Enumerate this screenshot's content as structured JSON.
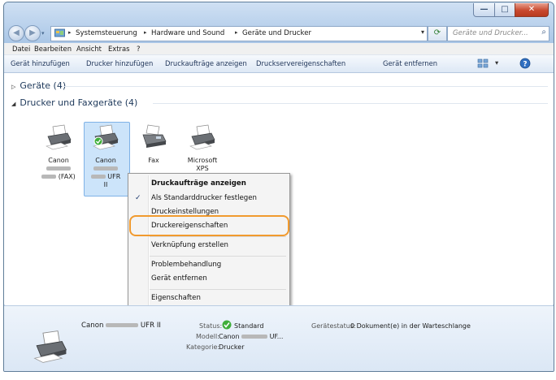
{
  "window_controls": {
    "minimize": "—",
    "maximize": "□",
    "close": "✕"
  },
  "nav": {
    "back_icon": "back-arrow-icon",
    "forward_icon": "forward-arrow-icon"
  },
  "address": {
    "crumbs": [
      "Systemsteuerung",
      "Hardware und Sound",
      "Geräte und Drucker"
    ],
    "separator": "▸"
  },
  "search": {
    "placeholder": "Geräte und Drucker... "
  },
  "menubar": [
    "Datei",
    "Bearbeiten",
    "Ansicht",
    "Extras",
    "?"
  ],
  "commandbar": [
    "Gerät hinzufügen",
    "Drucker hinzufügen",
    "Druckaufträge anzeigen",
    "Druckserver­eigenschaften",
    "Gerät entfernen"
  ],
  "groups": {
    "devices": "Geräte (4)",
    "printers": "Drucker und Faxgeräte (4)"
  },
  "printers": [
    {
      "name1": "Canon",
      "name2": "(FAX)"
    },
    {
      "name1": "Canon",
      "name2": "UFR",
      "name3": "II"
    },
    {
      "name1": "Fax"
    },
    {
      "name1": "Microsoft",
      "name2": "XPS"
    }
  ],
  "context_menu": [
    "Druckaufträge anzeigen",
    "Als Standarddrucker festlegen",
    "Druckeinstellungen",
    "Druckereigenschaften",
    "Verknüpfung erstellen",
    "Problembehandlung",
    "Gerät entfernen",
    "Eigenschaften"
  ],
  "details": {
    "name_prefix": "Canon",
    "name_suffix": "UFR II",
    "status_label": "Status:",
    "status_value": "Standard",
    "model_label": "Modell:",
    "model_prefix": "Canon",
    "model_suffix": "UF...",
    "category_label": "Kategorie:",
    "category_value": "Drucker",
    "device_status_label": "Gerätestatus:",
    "device_status_value": "0 Dokument(e) in der Warteschlange"
  },
  "colors": {
    "highlight": "#f19a2e",
    "selection": "#cce4fa"
  }
}
